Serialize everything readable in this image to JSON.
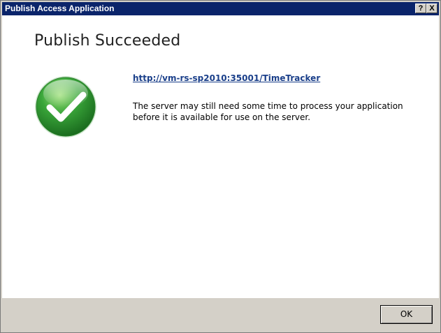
{
  "window": {
    "title": "Publish Access Application",
    "help_label": "?",
    "close_label": "X"
  },
  "main": {
    "heading": "Publish Succeeded",
    "link_text": "http://vm-rs-sp2010:35001/TimeTracker",
    "message": "The server may still need some time to process your application before it is available for use on the server.",
    "status_icon": "success-check-icon"
  },
  "footer": {
    "ok_label": "OK"
  },
  "colors": {
    "titlebar": "#0a246a",
    "link": "#1a3f8a",
    "check_green": "#3aa63a",
    "dialog_face": "#d4d0c8"
  }
}
